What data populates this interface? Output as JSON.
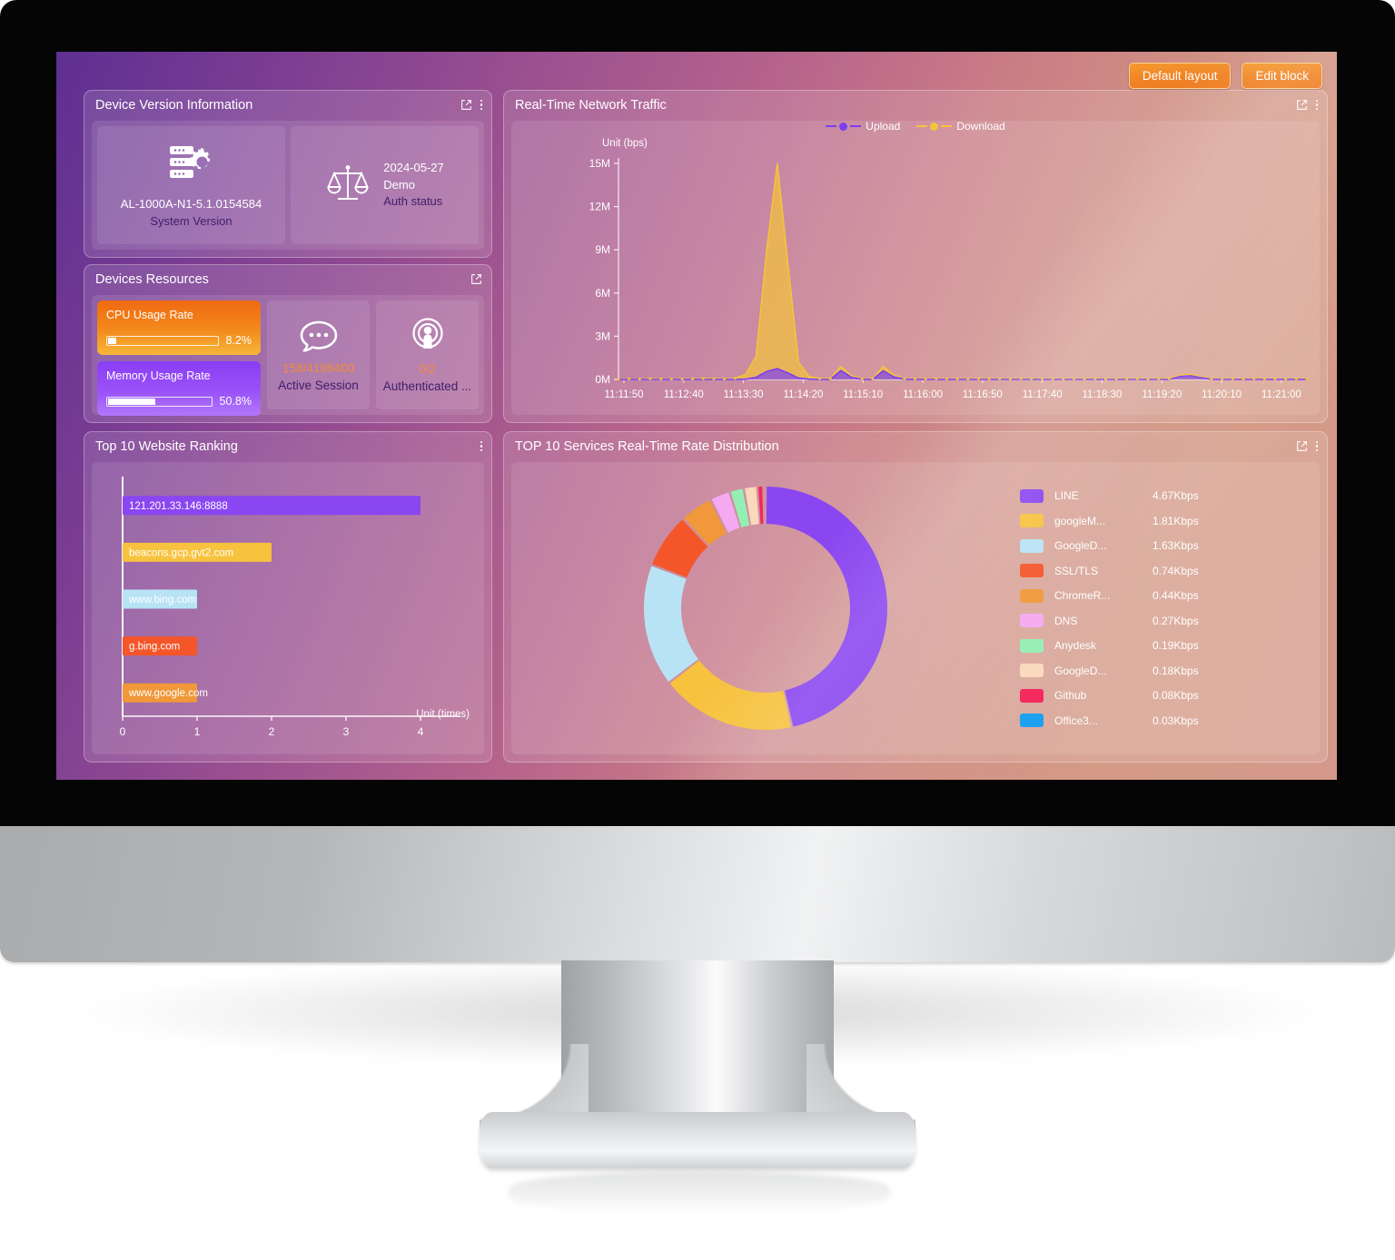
{
  "toolbar": {
    "default_layout_label": "Default layout",
    "edit_block_label": "Edit block"
  },
  "panels": {
    "device_version": {
      "title": "Device Version Information",
      "icons": [
        "external-link-icon",
        "more-vertical-icon"
      ],
      "cards": [
        {
          "icon": "server-gear-icon",
          "value": "AL-1000A-N1-5.1.0154584",
          "label": "System Version"
        },
        {
          "icon": "scales-balance-icon",
          "line1": "2024-05-27",
          "line2": "Demo",
          "label": "Auth status"
        }
      ]
    },
    "devices_resources": {
      "title": "Devices Resources",
      "icons": [
        "external-link-icon"
      ],
      "meters": [
        {
          "label": "CPU Usage Rate",
          "value": "8.2%",
          "percent": 8.2,
          "color": "#f08a1b"
        },
        {
          "label": "Memory Usage Rate",
          "value": "50.8%",
          "percent": 50.8,
          "color": "#9a52f7"
        }
      ],
      "stats": [
        {
          "icon": "chat-bubble-icon",
          "value": "158/4198400",
          "label": "Active Session"
        },
        {
          "icon": "broadcast-user-icon",
          "value": "0/2",
          "label": "Authenticated ..."
        }
      ]
    },
    "network_traffic": {
      "title": "Real-Time Network Traffic",
      "icons": [
        "external-link-icon",
        "more-vertical-icon"
      ]
    },
    "website_ranking": {
      "title": "Top 10 Website Ranking",
      "icons": [
        "more-vertical-icon"
      ]
    },
    "services_rate": {
      "title": "TOP 10 Services Real-Time Rate Distribution",
      "icons": [
        "external-link-icon",
        "more-vertical-icon"
      ]
    }
  },
  "chart_data": [
    {
      "id": "network-traffic",
      "type": "area",
      "title": "Real-Time Network Traffic",
      "ylabel": "Unit (bps)",
      "xlabel": "",
      "ylim": [
        0,
        15000000
      ],
      "yticks": [
        "0M",
        "3M",
        "6M",
        "9M",
        "12M",
        "15M"
      ],
      "xticks": [
        "11:11:50",
        "11:12:40",
        "11:13:30",
        "11:14:20",
        "11:15:10",
        "11:16:00",
        "11:16:50",
        "11:17:40",
        "11:18:30",
        "11:19:20",
        "11:20:10",
        "11:21:00"
      ],
      "legend": [
        {
          "name": "Upload",
          "color": "#7b3ff2"
        },
        {
          "name": "Download",
          "color": "#f5c33b"
        }
      ],
      "legend_position": "top-center",
      "grid": false,
      "series": [
        {
          "name": "Download",
          "color": "#f5c33b",
          "values": [
            0.02,
            0.03,
            0.02,
            0.05,
            0.03,
            0.02,
            0.04,
            0.03,
            0.06,
            0.05,
            0.04,
            0.08,
            0.35,
            1.6,
            9.0,
            15.0,
            8.0,
            1.2,
            0.2,
            0.06,
            0.05,
            0.9,
            0.25,
            0.05,
            0.04,
            0.9,
            0.3,
            0.05,
            0.04,
            0.03,
            0.05,
            0.03,
            0.04,
            0.02,
            0.05,
            0.03,
            0.04,
            0.02,
            0.05,
            0.03,
            0.04,
            0.03,
            0.02,
            0.04,
            0.03,
            0.05,
            0.02,
            0.04,
            0.03,
            0.05,
            0.02,
            0.04,
            0.06,
            0.3,
            0.35,
            0.2,
            0.05,
            0.03,
            0.04,
            0.02,
            0.05,
            0.03,
            0.04,
            0.02,
            0.05,
            0.03
          ]
        },
        {
          "name": "Upload",
          "color": "#7b3ff2",
          "values": [
            0.0,
            0.0,
            0.0,
            0.0,
            0.0,
            0.0,
            0.0,
            0.0,
            0.0,
            0.0,
            0.0,
            0.0,
            0.02,
            0.15,
            0.55,
            0.75,
            0.45,
            0.1,
            0.02,
            0.0,
            0.0,
            0.62,
            0.15,
            0.01,
            0.0,
            0.6,
            0.18,
            0.01,
            0.0,
            0.0,
            0.0,
            0.0,
            0.0,
            0.0,
            0.0,
            0.0,
            0.0,
            0.0,
            0.0,
            0.0,
            0.0,
            0.0,
            0.0,
            0.0,
            0.0,
            0.0,
            0.0,
            0.0,
            0.0,
            0.0,
            0.0,
            0.0,
            0.0,
            0.2,
            0.26,
            0.12,
            0.01,
            0.0,
            0.0,
            0.0,
            0.0,
            0.0,
            0.0,
            0.0,
            0.0,
            0.0
          ]
        }
      ]
    },
    {
      "id": "website-ranking",
      "type": "bar",
      "orientation": "horizontal",
      "title": "Top 10 Website Ranking",
      "xlabel": "Unit (times)",
      "ylabel": "",
      "xlim": [
        0,
        4
      ],
      "xticks": [
        "0",
        "1",
        "2",
        "3",
        "4"
      ],
      "grid": false,
      "categories": [
        "121.201.33.146:8888",
        "beacons.gcp.gvt2.com",
        "www.bing.com",
        "g.bing.com",
        "www.google.com"
      ],
      "values": [
        4,
        2,
        1,
        1,
        1
      ],
      "colors": [
        "#8a46f0",
        "#f7c23e",
        "#b8e3f5",
        "#f4562a",
        "#f0983a"
      ]
    },
    {
      "id": "services-rate",
      "type": "pie",
      "variant": "donut",
      "title": "TOP 10 Services Real-Time Rate Distribution",
      "unit": "Kbps",
      "legend_position": "right",
      "labels": [
        "LINE",
        "googleM...",
        "GoogleD...",
        "SSL/TLS",
        "ChromeR...",
        "DNS",
        "Anydesk",
        "GoogleD...",
        "Github",
        "Office3..."
      ],
      "values": [
        4.67,
        1.81,
        1.63,
        0.74,
        0.44,
        0.27,
        0.19,
        0.18,
        0.08,
        0.03
      ],
      "value_labels": [
        "4.67Kbps",
        "1.81Kbps",
        "1.63Kbps",
        "0.74Kbps",
        "0.44Kbps",
        "0.27Kbps",
        "0.19Kbps",
        "0.18Kbps",
        "0.08Kbps",
        "0.03Kbps"
      ],
      "colors": [
        "#8a46f0",
        "#f7c23e",
        "#b8e3f5",
        "#f4562a",
        "#f0983a",
        "#f5a9f0",
        "#94efb4",
        "#fad9bc",
        "#f5265b",
        "#1a9ff0"
      ]
    }
  ]
}
